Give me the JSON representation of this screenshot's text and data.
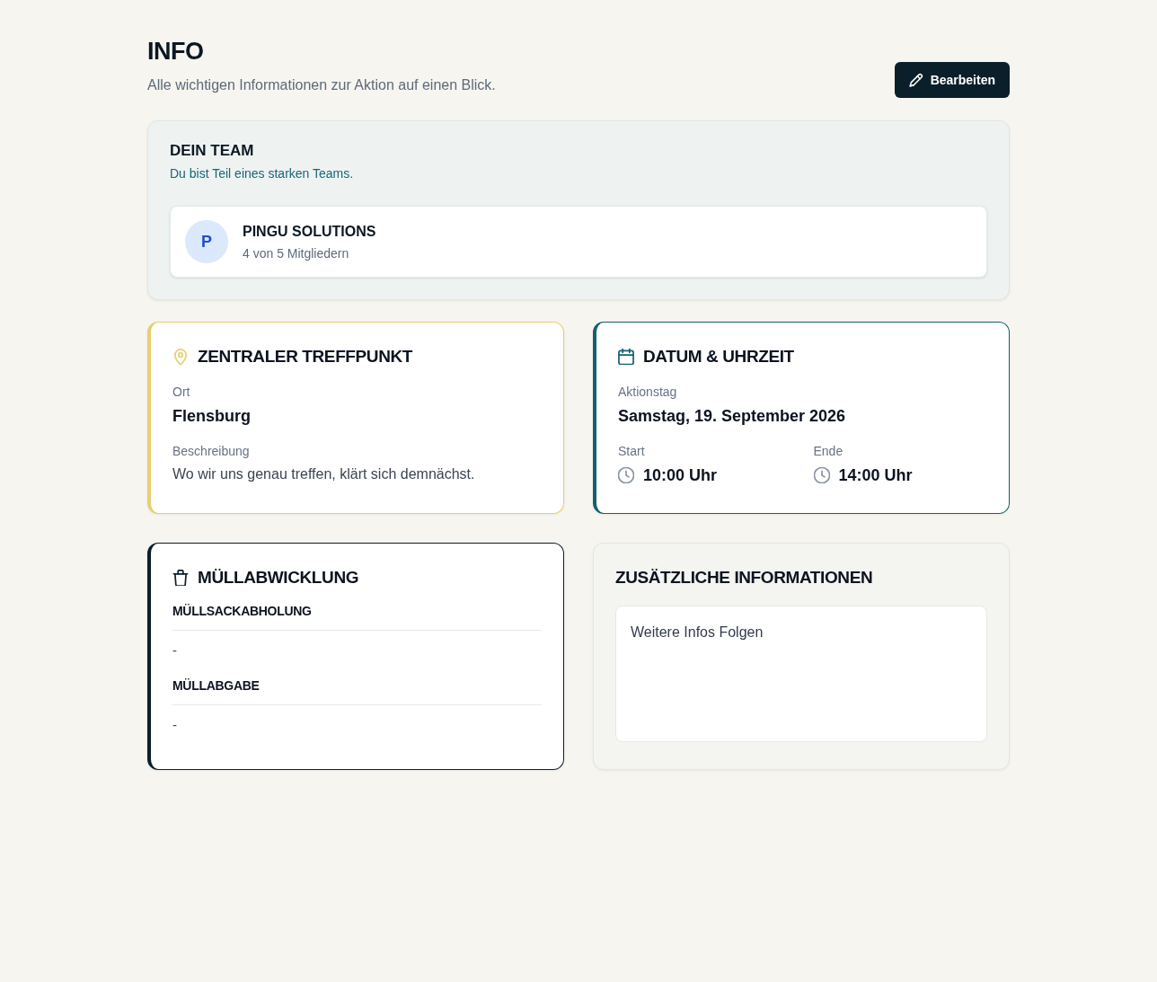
{
  "header": {
    "title": "INFO",
    "subtitle": "Alle wichtigen Informationen zur Aktion auf einen Blick.",
    "edit_button": {
      "label": "Bearbeiten"
    }
  },
  "team_section": {
    "title": "DEIN TEAM",
    "subtitle": "Du bist Teil eines starken Teams.",
    "team": {
      "initial": "P",
      "name": "PINGU SOLUTIONS",
      "members": "4 von 5 Mitgliedern"
    }
  },
  "cards": [
    {
      "kind": "location",
      "title": "ZENTRALER TREFFPUNKT",
      "color": "#e6cf6e",
      "fields": [
        {
          "kind": "headline",
          "label": "Ort",
          "value": "Flensburg"
        },
        {
          "kind": "text",
          "label": "Beschreibung",
          "value": "Wo wir uns genau treffen, klärt sich demnächst."
        }
      ]
    },
    {
      "kind": "datetime",
      "title": "DATUM & UHRZEIT",
      "color": "#13606f",
      "date": {
        "label": "Aktionstag",
        "value": "Samstag, 19. September 2026"
      },
      "times": [
        {
          "label": "Start",
          "value": "10:00 Uhr"
        },
        {
          "label": "Ende",
          "value": "14:00 Uhr"
        }
      ]
    },
    {
      "kind": "waste",
      "title": "MÜLLABWICKLUNG",
      "color": "#0b1f2a",
      "sections": [
        {
          "label": "MÜLLSACKABHOLUNG",
          "value": "-"
        },
        {
          "label": "MÜLLABGABE",
          "value": "-"
        }
      ]
    },
    {
      "kind": "notes",
      "title": "ZUSÄTZLICHE INFORMATIONEN",
      "text": "Weitere Infos Folgen"
    }
  ]
}
